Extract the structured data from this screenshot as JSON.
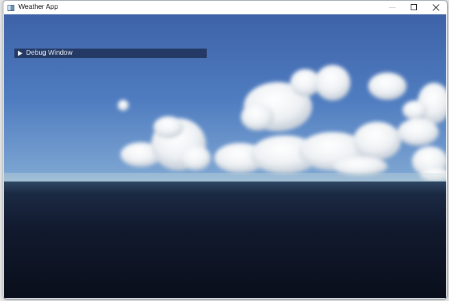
{
  "window": {
    "title": "Weather App",
    "icon": "app-window-icon",
    "controls": [
      {
        "name": "minimize",
        "icon": "minimize-icon"
      },
      {
        "name": "maximize",
        "icon": "maximize-icon"
      },
      {
        "name": "close",
        "icon": "close-icon"
      }
    ]
  },
  "scene": {
    "sky_color_top": "#3e62a8",
    "sky_color_horizon": "#b7cdd4",
    "ground_color": "#0a0e1b"
  },
  "debug_panel": {
    "label": "Debug Window",
    "collapsed": true,
    "arrow_icon": "expand-arrow-icon"
  }
}
